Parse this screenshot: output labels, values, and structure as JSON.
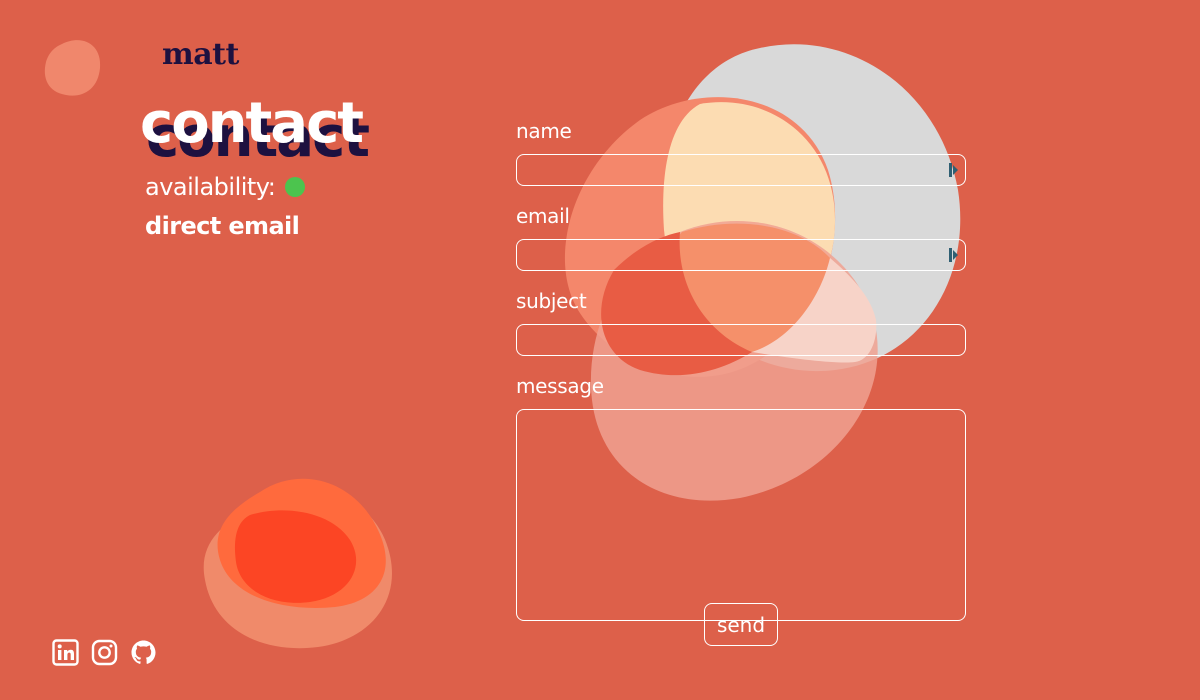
{
  "brand": {
    "logo_text": "matt"
  },
  "hero": {
    "title": "contact",
    "availability_label": "availability:",
    "availability_status_color": "#4cc44e",
    "direct_email_label": "direct email"
  },
  "form": {
    "fields": [
      {
        "label": "name",
        "value": ""
      },
      {
        "label": "email",
        "value": ""
      },
      {
        "label": "subject",
        "value": ""
      },
      {
        "label": "message",
        "value": ""
      }
    ],
    "submit_label": "send"
  },
  "social": {
    "icons": [
      "linkedin-icon",
      "instagram-icon",
      "github-icon"
    ]
  },
  "colors": {
    "background": "#dd604a",
    "text": "#ffffff",
    "logo_and_title_shadow": "#1d1140",
    "status_green": "#4cc44e"
  }
}
